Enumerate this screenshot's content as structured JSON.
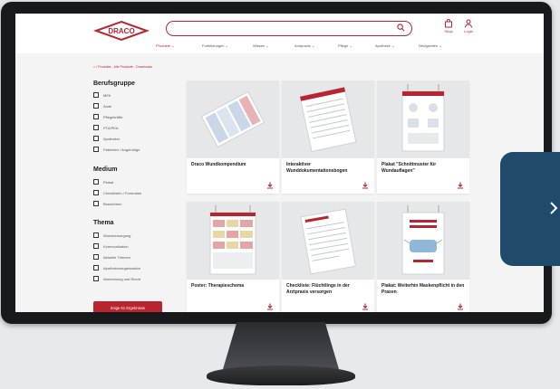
{
  "brand": {
    "logo_text": "DRACO",
    "accent": "#b9242f",
    "tab_color": "#1f4a6b"
  },
  "search": {
    "value": "",
    "placeholder": ""
  },
  "header": {
    "shop_label": "Shop",
    "login_label": "Login"
  },
  "nav": {
    "items": [
      {
        "label": "Produkte",
        "icon": "chevron-down-icon",
        "active": true
      },
      {
        "label": "Fortbildungen",
        "icon": "chevron-down-icon",
        "active": false
      },
      {
        "label": "Wissen",
        "icon": "chevron-down-icon",
        "active": false
      },
      {
        "label": "Arztpraxis",
        "icon": "chevron-down-icon",
        "active": false
      },
      {
        "label": "Pflege",
        "icon": "chevron-down-icon",
        "active": false
      },
      {
        "label": "Apotheke",
        "icon": "chevron-down-icon",
        "active": false
      },
      {
        "label": "Neuigkeiten",
        "icon": "chevron-down-icon",
        "active": false
      }
    ]
  },
  "breadcrumb": {
    "text": "/ Produkte - Alle Produkte - Downloads"
  },
  "filters": {
    "berufsgruppe": {
      "title": "Berufsgruppe",
      "options": [
        "MFA",
        "Ärzte",
        "Pflegekräfte",
        "PTA/PKA",
        "Apotheker",
        "Patienten / Angehörige"
      ]
    },
    "medium": {
      "title": "Medium",
      "options": [
        "Plakat",
        "Checklisten / Formulare",
        "Broschüren"
      ]
    },
    "thema": {
      "title": "Thema",
      "options": [
        "Wundversorgung",
        "Kommunikation",
        "Aktuelle Themen",
        "Apothekenorganisation",
        "Abrechnung und Recht"
      ]
    },
    "results_button": "Zeige 61 Ergebnisse"
  },
  "cards": [
    {
      "title": "Draco Wundkompendium",
      "icon": "download-icon"
    },
    {
      "title": "Interaktiver Wunddokumentationsbogen",
      "icon": "download-icon"
    },
    {
      "title": "Plakat \"Schnittmuster für Wundauflagen\"",
      "icon": "download-icon"
    },
    {
      "title": "Poster: Therapieschema",
      "icon": "download-icon"
    },
    {
      "title": "Checkliste: Flüchtlinge in der Arztpraxis versorgen",
      "icon": "download-icon"
    },
    {
      "title": "Plakat: Weiterhin Maskenpflicht in den Praxen",
      "icon": "download-icon"
    }
  ]
}
